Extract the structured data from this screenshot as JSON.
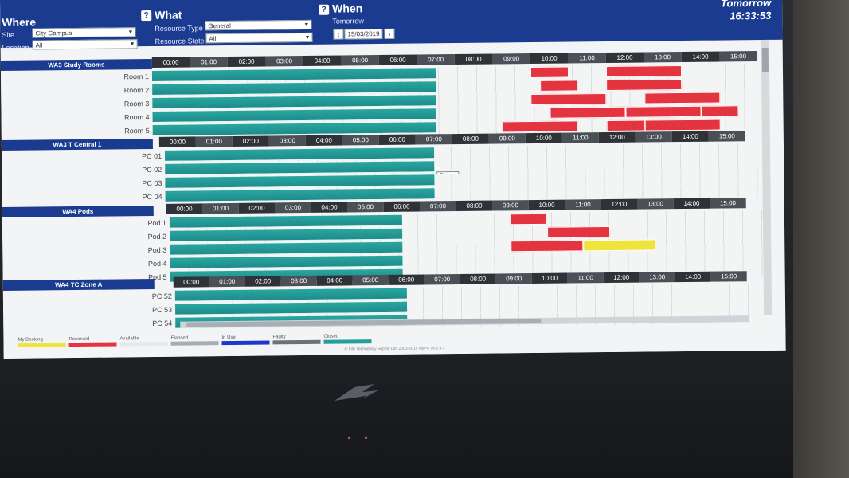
{
  "header": {
    "where": {
      "title": "Where",
      "site_label": "Site",
      "site_value": "City Campus",
      "location_label": "Location",
      "location_value": "All"
    },
    "what": {
      "title": "What",
      "resource_type_label": "Resource Type",
      "resource_type_value": "General",
      "resource_state_label": "Resource State",
      "resource_state_value": "All"
    },
    "when": {
      "title": "When",
      "day_label": "Tomorrow",
      "date_value": "15/03/2019"
    },
    "day": "Tomorrow",
    "clock": "16:33:53"
  },
  "sections": [
    {
      "title": "WA3 Study Rooms",
      "hours": [
        "00:00",
        "01:00",
        "02:00",
        "03:00",
        "04:00",
        "05:00",
        "06:00",
        "07:00",
        "08:00",
        "09:00",
        "10:00",
        "11:00",
        "12:00",
        "13:00",
        "14:00",
        "15:00"
      ],
      "rows": [
        {
          "label": "Room 1",
          "blocks": [
            {
              "type": "reserved",
              "from": 10.0,
              "to": 11.0
            },
            {
              "type": "reserved",
              "from": 12.0,
              "to": 14.0
            }
          ]
        },
        {
          "label": "Room 2",
          "blocks": [
            {
              "type": "reserved",
              "from": 10.25,
              "to": 11.25
            },
            {
              "type": "reserved",
              "from": 12.0,
              "to": 14.0
            }
          ]
        },
        {
          "label": "Room 3",
          "blocks": [
            {
              "type": "reserved",
              "from": 10.0,
              "to": 12.0
            },
            {
              "type": "reserved",
              "from": 13.0,
              "to": 15.0
            }
          ]
        },
        {
          "label": "Room 4",
          "blocks": [
            {
              "type": "reserved",
              "from": 10.5,
              "to": 12.5
            },
            {
              "type": "reserved",
              "from": 12.5,
              "to": 14.5
            },
            {
              "type": "reserved",
              "from": 14.5,
              "to": 15.5
            }
          ]
        },
        {
          "label": "Room 5",
          "blocks": [
            {
              "type": "reserved",
              "from": 9.25,
              "to": 11.25
            },
            {
              "type": "reserved",
              "from": 12.0,
              "to": 13.0
            },
            {
              "type": "reserved",
              "from": 13.0,
              "to": 15.0
            }
          ]
        }
      ]
    },
    {
      "title": "WA3 T Central 1",
      "hours": [
        "00:00",
        "01:00",
        "02:00",
        "03:00",
        "04:00",
        "05:00",
        "06:00",
        "07:00",
        "08:00",
        "09:00",
        "10:00",
        "11:00",
        "12:00",
        "13:00",
        "14:00",
        "15:00"
      ],
      "rows": [
        {
          "label": "PC 01",
          "blocks": []
        },
        {
          "label": "PC 02",
          "blocks": []
        },
        {
          "label": "PC 03",
          "blocks": []
        },
        {
          "label": "PC 04",
          "blocks": []
        }
      ]
    },
    {
      "title": "WA4 Pods",
      "hours": [
        "00:00",
        "01:00",
        "02:00",
        "03:00",
        "04:00",
        "05:00",
        "06:00",
        "07:00",
        "08:00",
        "09:00",
        "10:00",
        "11:00",
        "12:00",
        "13:00",
        "14:00",
        "15:00"
      ],
      "rows": [
        {
          "label": "Pod 1",
          "blocks": [
            {
              "type": "reserved",
              "from": 9.5,
              "to": 10.5
            }
          ]
        },
        {
          "label": "Pod 2",
          "blocks": [
            {
              "type": "reserved",
              "from": 10.5,
              "to": 12.25
            }
          ]
        },
        {
          "label": "Pod 3",
          "blocks": [
            {
              "type": "reserved",
              "from": 9.5,
              "to": 11.5
            },
            {
              "type": "booking",
              "from": 11.5,
              "to": 13.5
            }
          ]
        },
        {
          "label": "Pod 4",
          "blocks": []
        },
        {
          "label": "Pod 5",
          "blocks": []
        }
      ]
    },
    {
      "title": "WA4 TC Zone A",
      "hours": [
        "00:00",
        "01:00",
        "02:00",
        "03:00",
        "04:00",
        "05:00",
        "06:00",
        "07:00",
        "08:00",
        "09:00",
        "10:00",
        "11:00",
        "12:00",
        "13:00",
        "14:00",
        "15:00"
      ],
      "rows": [
        {
          "label": "PC 52",
          "blocks": []
        },
        {
          "label": "PC 53",
          "blocks": []
        },
        {
          "label": "PC 54",
          "blocks": []
        }
      ]
    }
  ],
  "closed_until": [
    7.5,
    7.5,
    6.5,
    6.5
  ],
  "tooltip": "Closed",
  "legend": [
    {
      "label": "My Booking",
      "color": "#f0e33c"
    },
    {
      "label": "Reserved",
      "color": "#e4343f"
    },
    {
      "label": "Available",
      "color": "#e6e9ec"
    },
    {
      "label": "Elapsed",
      "color": "#a9adb2"
    },
    {
      "label": "In Use",
      "color": "#1f37c8"
    },
    {
      "label": "Faulty",
      "color": "#6d7075"
    },
    {
      "label": "Closed",
      "color": "#24a09c"
    }
  ],
  "copyright": "© Info Technology Supply Ltd. 2003-2018 MyPC v6.2.4.3"
}
